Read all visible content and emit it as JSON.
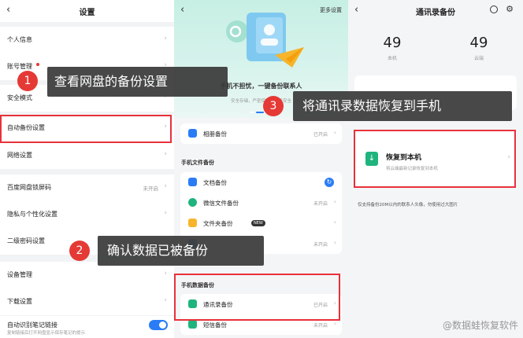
{
  "panel1": {
    "title": "设置",
    "back": "‹",
    "items": [
      {
        "label": "个人信息",
        "value": ""
      },
      {
        "label": "账号管理",
        "value": ""
      },
      {
        "label": "安全模式",
        "value": ""
      },
      {
        "label": "自动备份设置",
        "value": ""
      },
      {
        "label": "网络设置",
        "value": ""
      },
      {
        "label": "百度网盘锁屏码",
        "value": "未开启"
      },
      {
        "label": "隐私与个性化设置",
        "value": ""
      },
      {
        "label": "二级密码设置",
        "value": ""
      },
      {
        "label": "设备管理",
        "value": ""
      },
      {
        "label": "下载设置",
        "value": ""
      },
      {
        "label": "自动识别笔记链接",
        "value": "复制链接后打开网盘显示保存笔记的提示"
      }
    ]
  },
  "panel2": {
    "back": "‹",
    "more": "更多设置",
    "hero_text": "手机不担忧，一键备份联系人",
    "hero_sub": "安全存储，严密保护，资产安全",
    "album": {
      "label": "相册备份",
      "value": "已开启"
    },
    "section_files": "手机文件备份",
    "files": [
      {
        "label": "文档备份",
        "value": ""
      },
      {
        "label": "微信文件备份",
        "value": "未开启"
      },
      {
        "label": "文件夹备份",
        "value": "",
        "tag": "NEW"
      },
      {
        "label": "",
        "value": "未开启"
      }
    ],
    "section_data": "手机数据备份",
    "data": [
      {
        "label": "通讯录备份",
        "value": "已开启"
      },
      {
        "label": "短信备份",
        "value": "未开启"
      }
    ]
  },
  "panel3": {
    "title": "通讯录备份",
    "back": "‹",
    "local_count": "49",
    "local_label": "本机",
    "cloud_count": "49",
    "cloud_label": "云端",
    "restore_title": "恢复到本机",
    "restore_sub": "将云端最新记录恢复到本机",
    "note": "仅支持备份20M以内的联系人头像，勿使用过大图片"
  },
  "callouts": [
    {
      "num": "1",
      "text": "查看网盘的备份设置"
    },
    {
      "num": "2",
      "text": "确认数据已被备份"
    },
    {
      "num": "3",
      "text": "将通讯录数据恢复到手机"
    }
  ],
  "watermark": "@数据蛙恢复软件",
  "colors": {
    "accent": "#2a7cf6",
    "highlight": "#e8313a",
    "green": "#1fb47d"
  }
}
